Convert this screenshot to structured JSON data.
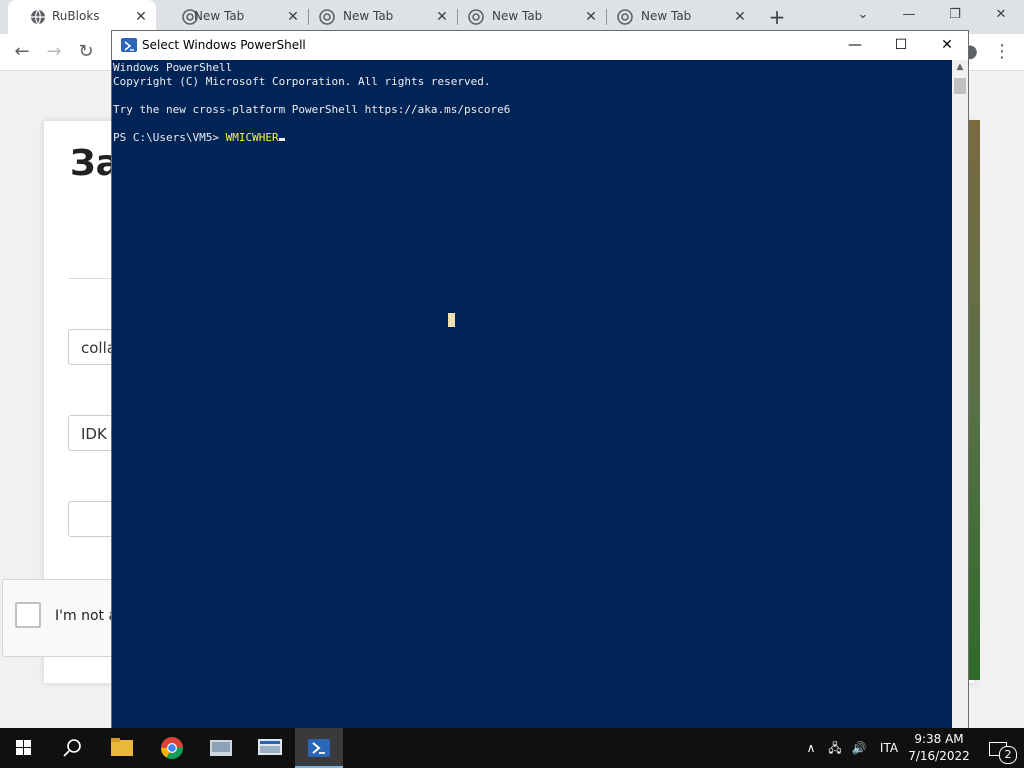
{
  "browser": {
    "tabs": [
      {
        "label": "RuBloks",
        "active": true
      },
      {
        "label": "New Tab",
        "active": false
      },
      {
        "label": "New Tab",
        "active": false
      },
      {
        "label": "New Tab",
        "active": false
      },
      {
        "label": "New Tab",
        "active": false
      }
    ],
    "page": {
      "heading": "За",
      "field1_value": "colla",
      "field2_value": "IDK",
      "captcha_label": "I'm not a"
    }
  },
  "powershell": {
    "title": "Select Windows PowerShell",
    "lines": [
      "Windows PowerShell",
      "Copyright (C) Microsoft Corporation. All rights reserved.",
      "",
      "Try the new cross-platform PowerShell https://aka.ms/pscore6",
      ""
    ],
    "prompt": "PS C:\\Users\\VM5> ",
    "command": "WMICWHER",
    "colors": {
      "background": "#012456",
      "command": "#f5f543",
      "text": "#eeedf0"
    }
  },
  "taskbar": {
    "apps": [
      "start-icon",
      "search-icon",
      "file-explorer-icon",
      "chrome-icon",
      "app-icon",
      "app-icon-2",
      "powershell-icon"
    ],
    "language": "ITA",
    "time": "9:38 AM",
    "date": "7/16/2022",
    "notification_count": "2"
  }
}
